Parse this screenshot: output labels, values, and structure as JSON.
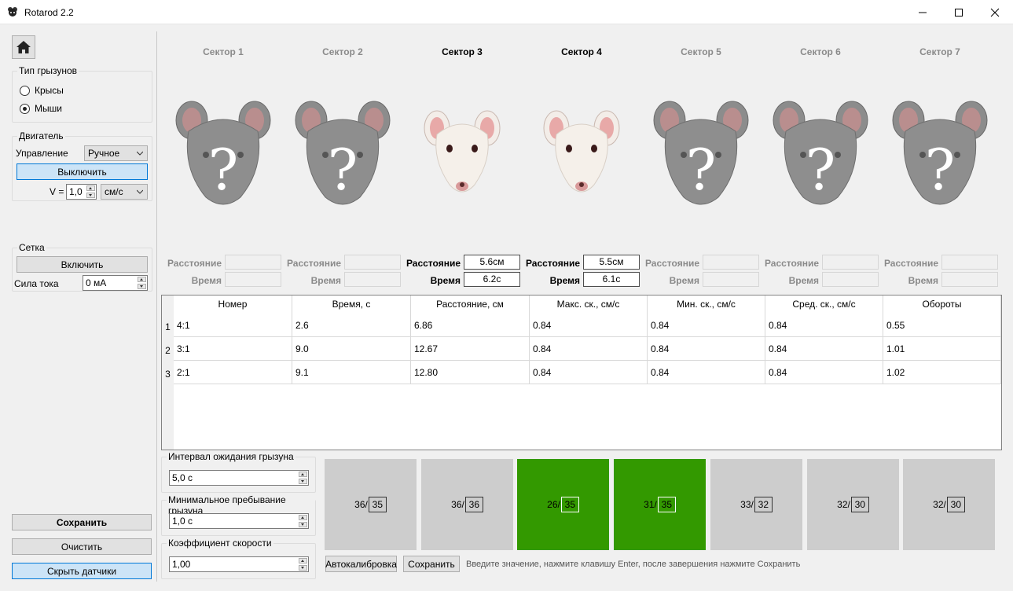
{
  "window": {
    "title": "Rotarod 2.2"
  },
  "rodent_type": {
    "title": "Тип грызунов",
    "options": [
      "Крысы",
      "Мыши"
    ],
    "selected": "Мыши"
  },
  "motor": {
    "title": "Двигатель",
    "control_label": "Управление",
    "control_value": "Ручное",
    "toggle_label": "Выключить",
    "v_label": "V =",
    "v_value": "1,0",
    "unit_value": "см/с"
  },
  "grid": {
    "title": "Сетка",
    "toggle_label": "Включить",
    "current_label": "Сила тока",
    "current_value": "0 мА"
  },
  "left_buttons": {
    "save": "Сохранить",
    "clear": "Очистить",
    "hide_sensors": "Скрыть датчики"
  },
  "sectors": [
    {
      "name": "Сектор 1",
      "active": false,
      "distance": "",
      "time": ""
    },
    {
      "name": "Сектор 2",
      "active": false,
      "distance": "",
      "time": ""
    },
    {
      "name": "Сектор 3",
      "active": true,
      "distance": "5.6см",
      "time": "6.2с"
    },
    {
      "name": "Сектор 4",
      "active": true,
      "distance": "5.5см",
      "time": "6.1с"
    },
    {
      "name": "Сектор 5",
      "active": false,
      "distance": "",
      "time": ""
    },
    {
      "name": "Сектор 6",
      "active": false,
      "distance": "",
      "time": ""
    },
    {
      "name": "Сектор 7",
      "active": false,
      "distance": "",
      "time": ""
    }
  ],
  "sector_labels": {
    "distance": "Расстояние",
    "time": "Время",
    "unknown_glyph": "?"
  },
  "results_table": {
    "columns": [
      "Номер",
      "Время, с",
      "Расстояние, см",
      "Макс. ск., см/с",
      "Мин. ск., см/с",
      "Сред. ск., см/с",
      "Обороты"
    ],
    "rows": [
      {
        "n": "1",
        "cells": [
          "4:1",
          "2.6",
          "6.86",
          "0.84",
          "0.84",
          "0.84",
          "0.55"
        ]
      },
      {
        "n": "2",
        "cells": [
          "3:1",
          "9.0",
          "12.67",
          "0.84",
          "0.84",
          "0.84",
          "1.01"
        ]
      },
      {
        "n": "3",
        "cells": [
          "2:1",
          "9.1",
          "12.80",
          "0.84",
          "0.84",
          "0.84",
          "1.02"
        ]
      }
    ]
  },
  "params": [
    {
      "title": "Интервал ожидания грызуна",
      "value": "5,0 с"
    },
    {
      "title": "Минимальное пребывание грызуна",
      "value": "1,0 с"
    },
    {
      "title": "Коэффициент скорости",
      "value": "1,00"
    }
  ],
  "sensors": [
    {
      "left": "36/",
      "value": "35",
      "state": "gray"
    },
    {
      "left": "36/",
      "value": "36",
      "state": "gray"
    },
    {
      "left": "26/",
      "value": "35",
      "state": "green"
    },
    {
      "left": "31/",
      "value": "35",
      "state": "green"
    },
    {
      "left": "33/",
      "value": "32",
      "state": "gray"
    },
    {
      "left": "32/",
      "value": "30",
      "state": "gray"
    },
    {
      "left": "32/",
      "value": "30",
      "state": "gray"
    }
  ],
  "sensor_actions": {
    "autocalibrate": "Автокалибровка",
    "save": "Сохранить",
    "hint": "Введите значение, нажмите клавишу Enter, после завершения нажмите Сохранить"
  },
  "colors": {
    "active_green": "#339900",
    "inactive_tile": "#cdcdcd",
    "selected_button": "#cce4f7"
  }
}
